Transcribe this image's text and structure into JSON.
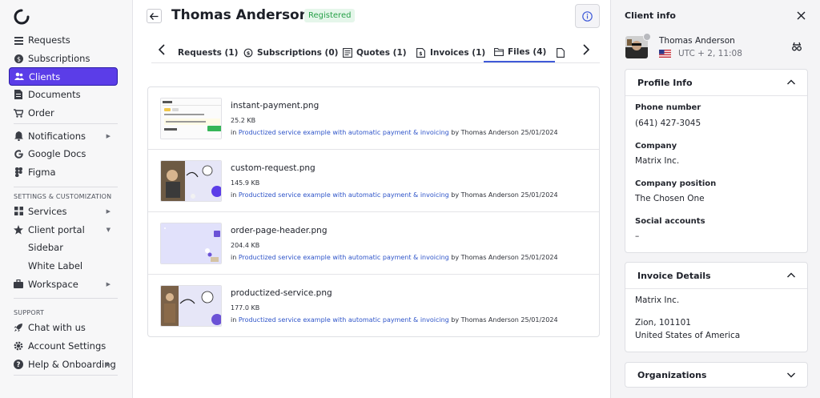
{
  "sidebar": {
    "items": [
      {
        "label": "Requests",
        "icon": "list-icon"
      },
      {
        "label": "Subscriptions",
        "icon": "dollar-circle-icon"
      },
      {
        "label": "Clients",
        "icon": "users-icon"
      },
      {
        "label": "Documents",
        "icon": "document-icon"
      },
      {
        "label": "Order",
        "icon": "cart-icon"
      }
    ],
    "items2": [
      {
        "label": "Notifications",
        "icon": "bell-icon"
      },
      {
        "label": "Google Docs",
        "icon": "google-icon"
      },
      {
        "label": "Figma",
        "icon": "figma-icon"
      }
    ],
    "settings_title": "SETTINGS & CUSTOMIZATION",
    "settings_items": [
      {
        "label": "Services",
        "icon": "grid-icon"
      },
      {
        "label": "Client portal",
        "icon": "star-icon"
      },
      {
        "label": "Sidebar"
      },
      {
        "label": "White Label"
      },
      {
        "label": "Workspace",
        "icon": "briefcase-icon"
      }
    ],
    "support_title": "SUPPORT",
    "support_items": [
      {
        "label": "Chat with us",
        "icon": "rocket-icon"
      },
      {
        "label": "Account Settings",
        "icon": "gear-icon"
      },
      {
        "label": "Help & Onboarding",
        "icon": "help-icon"
      }
    ]
  },
  "header": {
    "client_name": "Thomas Anderson",
    "status_badge": "Registered"
  },
  "tabs": [
    {
      "label": "Requests (1)",
      "icon": "none"
    },
    {
      "label": "Subscriptions (0)",
      "icon": "refresh-dollar-icon"
    },
    {
      "label": "Quotes (1)",
      "icon": "quote-icon"
    },
    {
      "label": "Invoices (1)",
      "icon": "invoice-icon"
    },
    {
      "label": "Files (4)",
      "icon": "folder-icon",
      "active": true
    }
  ],
  "files": [
    {
      "name": "instant-payment.png",
      "size": "25.2 KB",
      "in_label": "in",
      "link": "Productized service example with automatic payment & invoicing",
      "by": "by Thomas Anderson 25/01/2024"
    },
    {
      "name": "custom-request.png",
      "size": "145.9 KB",
      "in_label": "in",
      "link": "Productized service example with automatic payment & invoicing",
      "by": "by Thomas Anderson 25/01/2024"
    },
    {
      "name": "order-page-header.png",
      "size": "204.4 KB",
      "in_label": "in",
      "link": "Productized service example with automatic payment & invoicing",
      "by": "by Thomas Anderson 25/01/2024"
    },
    {
      "name": "productized-service.png",
      "size": "177.0 KB",
      "in_label": "in",
      "link": "Productized service example with automatic payment & invoicing",
      "by": "by Thomas Anderson 25/01/2024"
    }
  ],
  "panel": {
    "title": "Client info",
    "name": "Thomas Anderson",
    "timezone": "UTC + 2, 11:08",
    "profile": {
      "title": "Profile Info",
      "phone_label": "Phone number",
      "phone": "(641) 427-3045",
      "company_label": "Company",
      "company": "Matrix Inc.",
      "position_label": "Company position",
      "position": "The Chosen One",
      "social_label": "Social accounts",
      "social": "–"
    },
    "invoice": {
      "title": "Invoice Details",
      "company": "Matrix Inc.",
      "address1": "Zion, 101101",
      "address2": "United States of America"
    },
    "organizations": {
      "title": "Organizations"
    }
  },
  "colors": {
    "accent": "#5b3de8",
    "link": "#2f55c9",
    "badge_bg": "#e5f6ea",
    "badge_text": "#27a048"
  }
}
